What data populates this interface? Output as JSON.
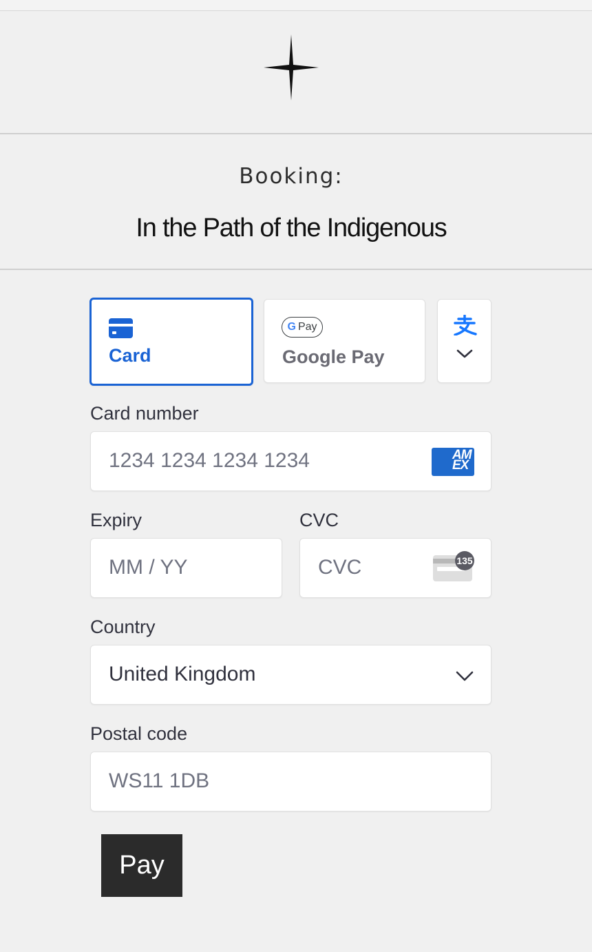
{
  "header": {
    "booking_label": "Booking:",
    "booking_title": "In the Path of the Indigenous"
  },
  "payment_methods": {
    "card_label": "Card",
    "gpay_label": "Google Pay",
    "gpay_badge": "Pay",
    "selected": "Card",
    "accent_color": "#1a63d4"
  },
  "form": {
    "card_number": {
      "label": "Card number",
      "placeholder": "1234 1234 1234 1234",
      "brand_icon": "amex-icon",
      "brand_text": "AM EX"
    },
    "expiry": {
      "label": "Expiry",
      "placeholder": "MM / YY"
    },
    "cvc": {
      "label": "CVC",
      "placeholder": "CVC",
      "icon_badge": "135"
    },
    "country": {
      "label": "Country",
      "value": "United Kingdom"
    },
    "postal_code": {
      "label": "Postal code",
      "placeholder": "WS11 1DB"
    }
  },
  "pay_button": {
    "label": "Pay"
  }
}
